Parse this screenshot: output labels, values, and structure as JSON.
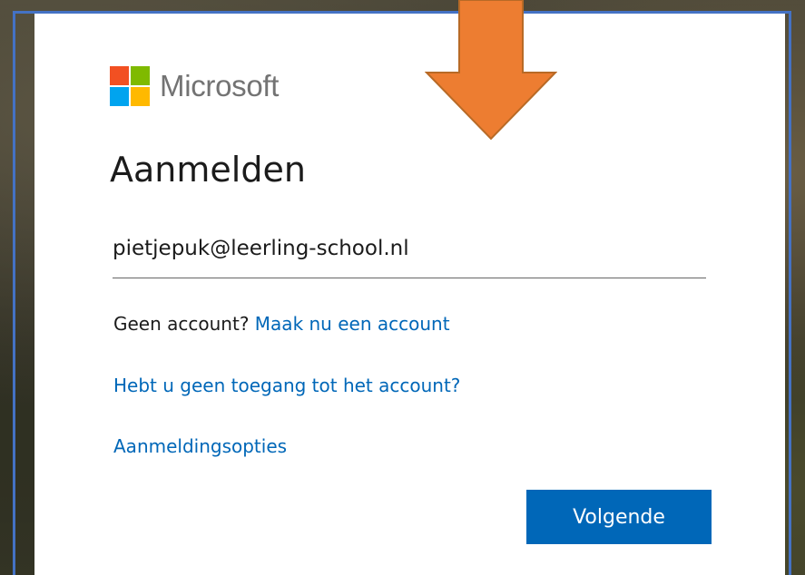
{
  "brand": {
    "name": "Microsoft",
    "logo_colors": [
      "#f25022",
      "#7fba00",
      "#00a4ef",
      "#ffb900"
    ]
  },
  "page_title": "Aanmelden",
  "email_input": {
    "value": "pietjepuk@leerling-school.nl"
  },
  "no_account": {
    "prefix": "Geen account?",
    "link": "Maak nu een account"
  },
  "no_access_link": "Hebt u geen toegang tot het account?",
  "signin_options_link": "Aanmeldingsopties",
  "next_button": "Volgende",
  "colors": {
    "accent": "#0067b8",
    "annotation_arrow": "#ed7d31",
    "annotation_frame": "#4472c4"
  },
  "annotation": {
    "arrow_icon": "down-arrow-icon"
  }
}
